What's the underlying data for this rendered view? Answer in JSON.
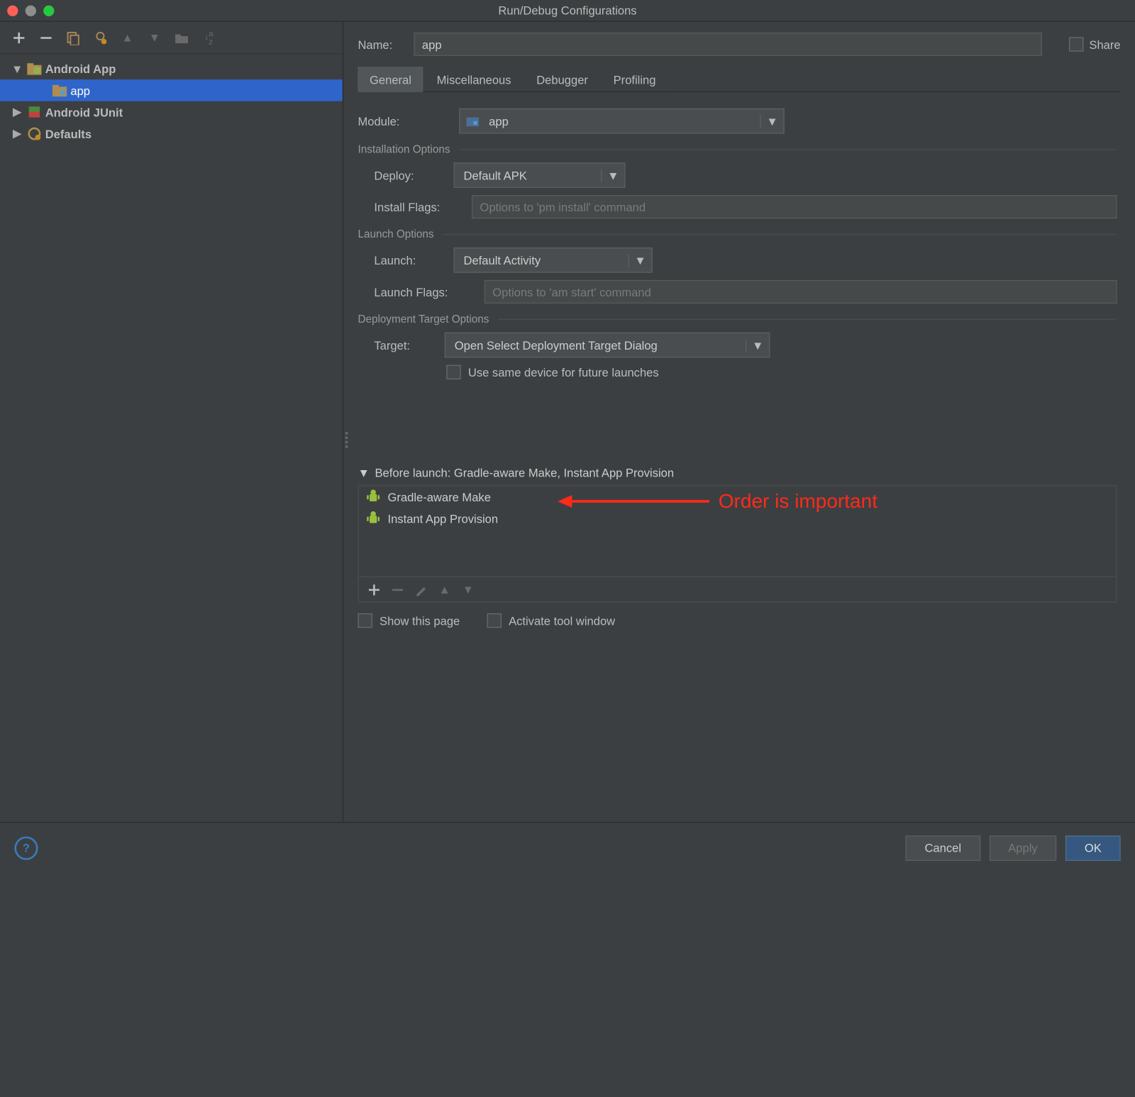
{
  "window": {
    "title": "Run/Debug Configurations"
  },
  "sidebar": {
    "items": [
      {
        "label": "Android App",
        "level": 0,
        "twisty": "▼",
        "icon": "android-app-folder-icon",
        "bold": true,
        "sel": false
      },
      {
        "label": "app",
        "level": 1,
        "twisty": "",
        "icon": "app-icon",
        "bold": false,
        "sel": true
      },
      {
        "label": "Android JUnit",
        "level": 0,
        "twisty": "▶",
        "icon": "junit-icon",
        "bold": true,
        "sel": false
      },
      {
        "label": "Defaults",
        "level": 0,
        "twisty": "▶",
        "icon": "wrench-gear-icon",
        "bold": true,
        "sel": false
      }
    ]
  },
  "name": {
    "label": "Name:",
    "value": "app"
  },
  "share": {
    "label": "Share"
  },
  "tabs": [
    {
      "label": "General",
      "active": true
    },
    {
      "label": "Miscellaneous",
      "active": false
    },
    {
      "label": "Debugger",
      "active": false
    },
    {
      "label": "Profiling",
      "active": false
    }
  ],
  "module": {
    "label": "Module:",
    "value": "app"
  },
  "install": {
    "section": "Installation Options",
    "deploy_label": "Deploy:",
    "deploy_value": "Default APK",
    "flags_label": "Install Flags:",
    "flags_placeholder": "Options to 'pm install' command"
  },
  "launch": {
    "section": "Launch Options",
    "launch_label": "Launch:",
    "launch_value": "Default Activity",
    "flags_label": "Launch Flags:",
    "flags_placeholder": "Options to 'am start' command"
  },
  "deploy_target": {
    "section": "Deployment Target Options",
    "target_label": "Target:",
    "target_value": "Open Select Deployment Target Dialog",
    "same_device_label": "Use same device for future launches"
  },
  "before_launch": {
    "header": "Before launch: Gradle-aware Make, Instant App Provision",
    "items": [
      {
        "label": "Gradle-aware Make"
      },
      {
        "label": "Instant App Provision"
      }
    ],
    "show_page": "Show this page",
    "activate_tool": "Activate tool window"
  },
  "annotation": {
    "text": "Order is important"
  },
  "buttons": {
    "cancel": "Cancel",
    "apply": "Apply",
    "ok": "OK"
  }
}
